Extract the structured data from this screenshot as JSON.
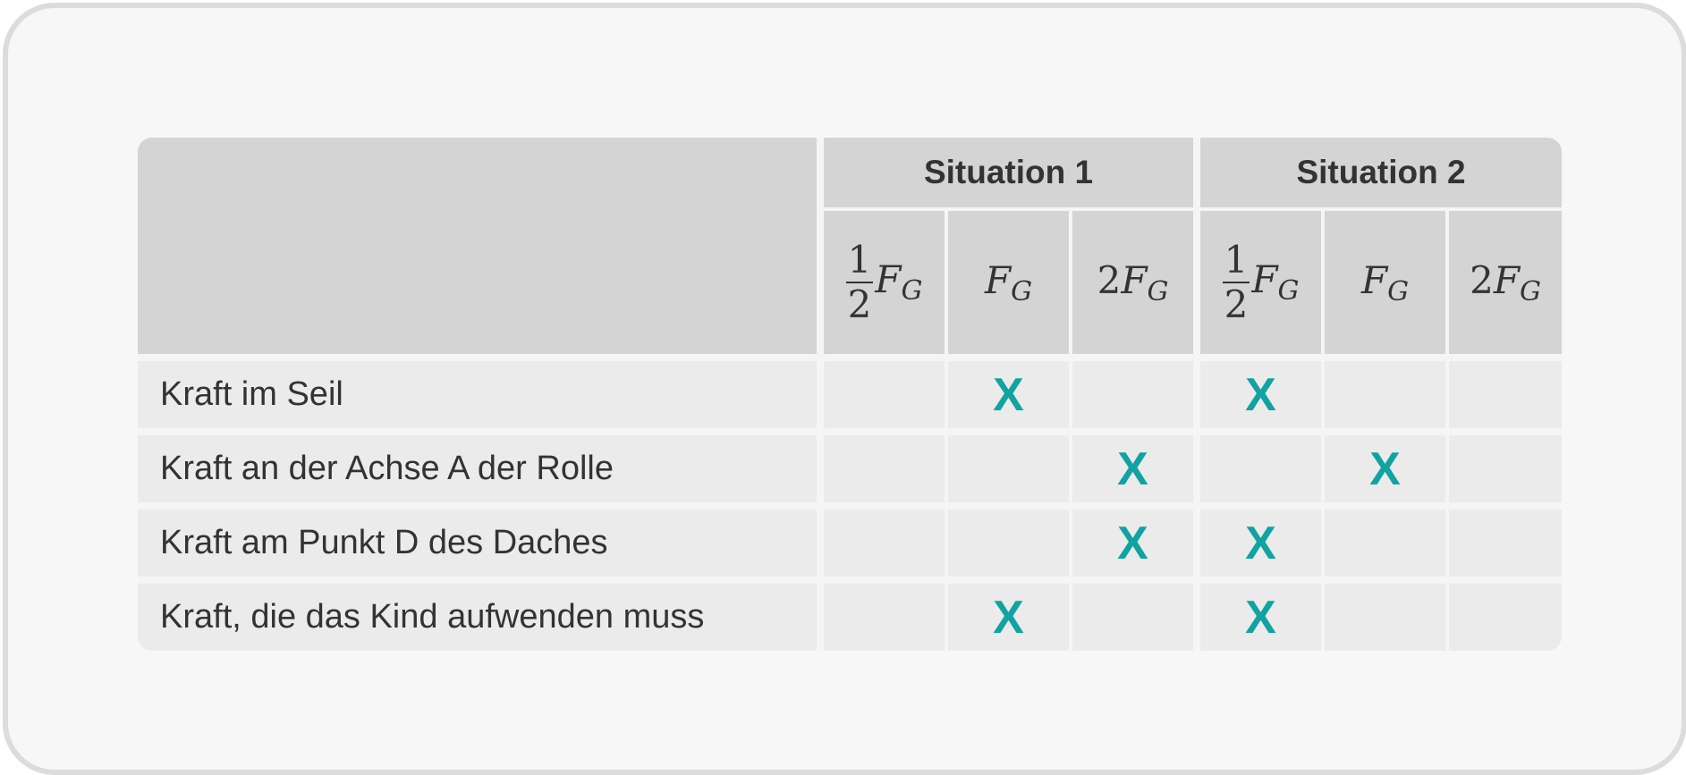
{
  "table": {
    "group_headers": [
      "Situation 1",
      "Situation 2"
    ],
    "sub_headers": [
      {
        "coef": "",
        "frac": [
          "1",
          "2"
        ],
        "var": "F",
        "sub": "G"
      },
      {
        "coef": "",
        "frac": null,
        "var": "F",
        "sub": "G"
      },
      {
        "coef": "2",
        "frac": null,
        "var": "F",
        "sub": "G"
      },
      {
        "coef": "",
        "frac": [
          "1",
          "2"
        ],
        "var": "F",
        "sub": "G"
      },
      {
        "coef": "",
        "frac": null,
        "var": "F",
        "sub": "G"
      },
      {
        "coef": "2",
        "frac": null,
        "var": "F",
        "sub": "G"
      }
    ],
    "rows": [
      {
        "label": "Kraft im Seil",
        "marks": [
          "",
          "X",
          "",
          "X",
          "",
          ""
        ]
      },
      {
        "label": "Kraft an der Achse A der Rolle",
        "marks": [
          "",
          "",
          "X",
          "",
          "X",
          ""
        ]
      },
      {
        "label": "Kraft am Punkt D des Daches",
        "marks": [
          "",
          "",
          "X",
          "X",
          "",
          ""
        ]
      },
      {
        "label": "Kraft, die das Kind aufwenden muss",
        "marks": [
          "",
          "X",
          "",
          "X",
          "",
          ""
        ]
      }
    ]
  },
  "colors": {
    "mark": "#11a2a2",
    "header_bg": "#d4d4d4",
    "row_bg": "#ebebeb",
    "card_border": "#dcdcdc"
  }
}
